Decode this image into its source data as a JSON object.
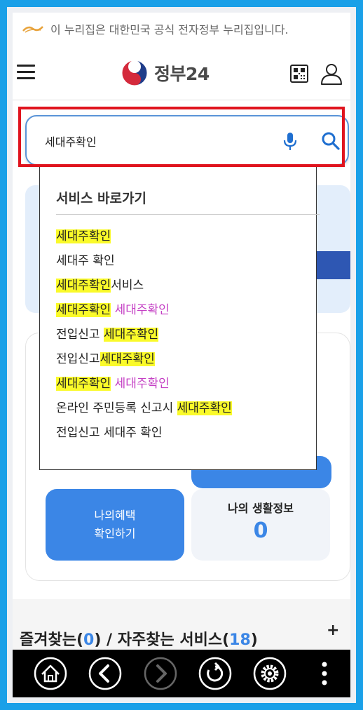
{
  "gov_banner": {
    "text": "이 누리집은 대한민국 공식 전자정부 누리집입니다."
  },
  "header": {
    "logo_text": "정부24"
  },
  "search": {
    "value": "세대주확인"
  },
  "dropdown": {
    "title": "서비스 바로가기",
    "items": [
      {
        "parts": [
          {
            "t": "세대주확인",
            "s": "hl"
          }
        ]
      },
      {
        "parts": [
          {
            "t": "세대주 확인",
            "s": ""
          }
        ]
      },
      {
        "parts": [
          {
            "t": "세대주확인",
            "s": "hl"
          },
          {
            "t": "서비스",
            "s": ""
          }
        ]
      },
      {
        "parts": [
          {
            "t": "세대주확인",
            "s": "hl"
          },
          {
            "t": " ",
            "s": ""
          },
          {
            "t": "세대주확인",
            "s": "pk"
          }
        ]
      },
      {
        "parts": [
          {
            "t": "전입신고 ",
            "s": ""
          },
          {
            "t": "세대주확인",
            "s": "hl"
          }
        ]
      },
      {
        "parts": [
          {
            "t": "전입신고",
            "s": ""
          },
          {
            "t": "세대주확인",
            "s": "hl"
          }
        ]
      },
      {
        "parts": [
          {
            "t": "세대주확인",
            "s": "hl"
          },
          {
            "t": " ",
            "s": ""
          },
          {
            "t": "세대주확인",
            "s": "pk"
          }
        ]
      },
      {
        "parts": [
          {
            "t": "온라인 주민등록 신고시 ",
            "s": ""
          },
          {
            "t": "세대주확인",
            "s": "hl"
          }
        ]
      },
      {
        "parts": [
          {
            "t": "전입신고 세대주 확인",
            "s": ""
          }
        ]
      }
    ]
  },
  "benefit_button": {
    "line1": "나의혜택",
    "line2": "확인하기"
  },
  "life_info": {
    "title": "나의 생활정보",
    "count": "0"
  },
  "favorites": {
    "prefix": "즐겨찾는(",
    "fav_count": "0",
    "middle": ") / 자주찾는 서비스(",
    "freq_count": "18",
    "suffix": ")",
    "plus": "+"
  },
  "nav_bar": {
    "buttons": [
      "home-icon",
      "back-icon",
      "forward-icon",
      "refresh-icon",
      "settings-icon",
      "more-vertical-icon"
    ]
  },
  "colors": {
    "frame": "#1aa0e8",
    "search_outline": "#e0141e",
    "accent_blue": "#3b86e6",
    "highlight": "#fafa2a",
    "match_pink": "#c43fc4",
    "nav_bar": "#000000"
  }
}
